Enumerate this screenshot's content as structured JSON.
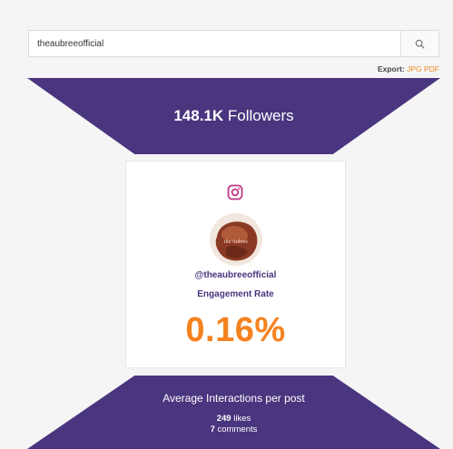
{
  "search": {
    "value": "theaubreeofficial",
    "placeholder": ""
  },
  "export": {
    "label": "Export:",
    "jpg": "JPG",
    "pdf": "PDF"
  },
  "followers": {
    "count": "148.1K",
    "label": "Followers"
  },
  "profile": {
    "platform_icon": "instagram-icon",
    "avatar_caption": "the Aubree",
    "handle": "@theaubreeofficial"
  },
  "engagement": {
    "label": "Engagement Rate",
    "value": "0.16%"
  },
  "interactions": {
    "title": "Average Interactions per post",
    "likes_count": "249",
    "likes_label": "likes",
    "comments_count": "7",
    "comments_label": "comments"
  },
  "colors": {
    "purple": "#4a357f",
    "orange": "#f58220",
    "link_orange": "#f08a24"
  }
}
